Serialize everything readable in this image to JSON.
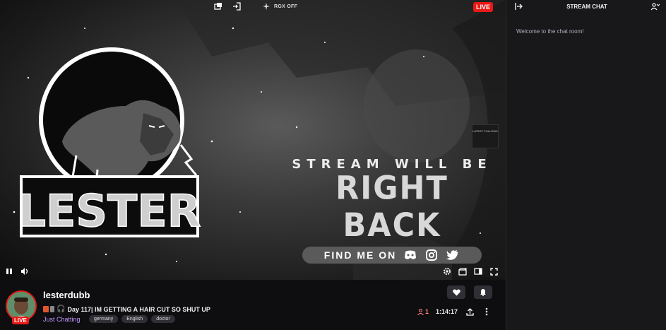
{
  "player": {
    "live_top": "LIVE",
    "rgx_label": "RGX OFF",
    "brb_top": "STREAM WILL BE",
    "brb_main": "RIGHT BACK",
    "find_me": "FIND ME ON",
    "follows": "LATEST FOLLOWS",
    "logo_text": "LESTER"
  },
  "chat": {
    "title": "STREAM CHAT",
    "welcome": "Welcome to the chat room!"
  },
  "info": {
    "streamer": "lesterdubb",
    "live_badge": "LIVE",
    "stream_title": "Day 117| IM GETTING A HAIR CUT SO SHUT UP",
    "category": "Just Chatting",
    "tags": [
      "germany",
      "English",
      "doctor"
    ],
    "viewers": "1",
    "uptime": "1:14:17"
  },
  "colors": {
    "live": "#e91916",
    "category": "#bf94ff",
    "viewers": "#ff8280"
  }
}
